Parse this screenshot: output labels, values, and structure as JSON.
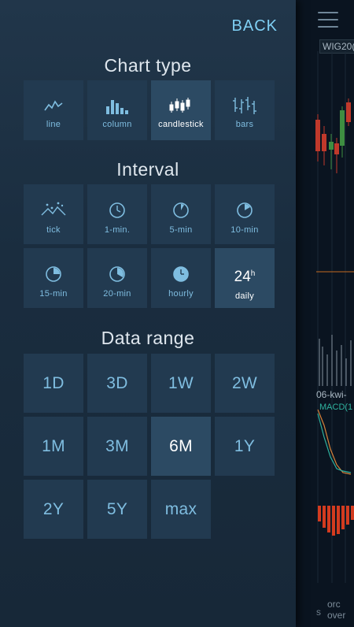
{
  "background": {
    "symbol": "WIG20(",
    "separator_label": "06-kwi-",
    "macd_label": "MACD(1",
    "bottom_tab_line1": "orc",
    "bottom_tab_line2": "over",
    "bottom_tab_prefix": "s"
  },
  "drawer": {
    "back_label": "BACK",
    "chart_type": {
      "title": "Chart type",
      "items": [
        {
          "label": "line",
          "icon": "line-chart-icon"
        },
        {
          "label": "column",
          "icon": "column-chart-icon"
        },
        {
          "label": "candlestick",
          "icon": "candlestick-chart-icon",
          "selected": true
        },
        {
          "label": "bars",
          "icon": "bars-chart-icon"
        }
      ]
    },
    "interval": {
      "title": "Interval",
      "items": [
        {
          "label": "tick",
          "icon": "tick-icon"
        },
        {
          "label": "1-min.",
          "icon": "clock-1min-icon"
        },
        {
          "label": "5-min",
          "icon": "clock-5min-icon"
        },
        {
          "label": "10-min",
          "icon": "clock-10min-icon"
        },
        {
          "label": "15-min",
          "icon": "clock-15min-icon"
        },
        {
          "label": "20-min",
          "icon": "clock-20min-icon"
        },
        {
          "label": "hourly",
          "icon": "clock-hourly-icon"
        },
        {
          "label": "daily",
          "icon": "daily-24h-icon",
          "icon_text": "24",
          "icon_sup": "h",
          "selected": true
        }
      ]
    },
    "data_range": {
      "title": "Data range",
      "items": [
        {
          "label": "1D"
        },
        {
          "label": "3D"
        },
        {
          "label": "1W"
        },
        {
          "label": "2W"
        },
        {
          "label": "1M"
        },
        {
          "label": "3M"
        },
        {
          "label": "6M",
          "selected": true
        },
        {
          "label": "1Y"
        },
        {
          "label": "2Y"
        },
        {
          "label": "5Y"
        },
        {
          "label": "max"
        }
      ]
    }
  },
  "colors": {
    "accent": "#7fd0f5",
    "cell_bg": "#223a50",
    "cell_selected_bg": "#2c4a63",
    "cell_text": "#7fbde0"
  }
}
